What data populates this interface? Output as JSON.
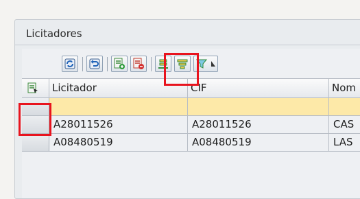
{
  "panel": {
    "title": "Licitadores"
  },
  "toolbar": {
    "buttons": [
      {
        "icon": "refresh-icon"
      },
      {
        "icon": "undo-icon"
      },
      {
        "icon": "add-row-icon"
      },
      {
        "icon": "remove-row-icon"
      },
      {
        "icon": "align-bottom-icon"
      },
      {
        "icon": "align-filter-icon"
      },
      {
        "icon": "filter-icon"
      }
    ],
    "highlight_color": "#e8141e"
  },
  "table": {
    "columns": [
      "Licitador",
      "CIF",
      "Nom"
    ],
    "rows": [
      {
        "licitador": "",
        "cif": "",
        "nom": "",
        "selected": true
      },
      {
        "licitador": "A28011526",
        "cif": "A28011526",
        "nom": "CAS",
        "selected": false
      },
      {
        "licitador": "A08480519",
        "cif": "A08480519",
        "nom": "LAS",
        "selected": false
      }
    ],
    "selected_row_color": "#fde9a8"
  }
}
